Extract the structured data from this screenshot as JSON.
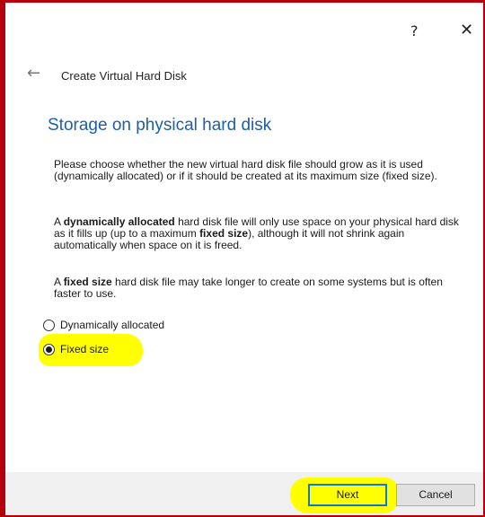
{
  "window": {
    "help_label": "?",
    "close_label": "✕"
  },
  "header": {
    "back_icon": "←",
    "title": "Create Virtual Hard Disk"
  },
  "page": {
    "title": "Storage on physical hard disk",
    "para1": "Please choose whether the new virtual hard disk file should grow as it is used (dynamically allocated) or if it should be created at its maximum size (fixed size).",
    "para2": {
      "t1": "A ",
      "b1": "dynamically allocated",
      "t2": " hard disk file will only use space on your physical hard disk as it fills up (up to a maximum ",
      "b2": "fixed size",
      "t3": "), although it will not shrink again automatically when space on it is freed."
    },
    "para3": {
      "t1": "A ",
      "b1": "fixed size",
      "t2": " hard disk file may take longer to create on some systems but is often faster to use."
    }
  },
  "options": [
    {
      "label": "Dynamically allocated",
      "selected": false
    },
    {
      "label": "Fixed size",
      "selected": true
    }
  ],
  "buttons": {
    "next": "Next",
    "cancel": "Cancel"
  },
  "colors": {
    "frame_border": "#b3000c",
    "title_blue": "#1d5fa5",
    "highlight": "#ffff00",
    "focus_border": "#0a78d7"
  }
}
